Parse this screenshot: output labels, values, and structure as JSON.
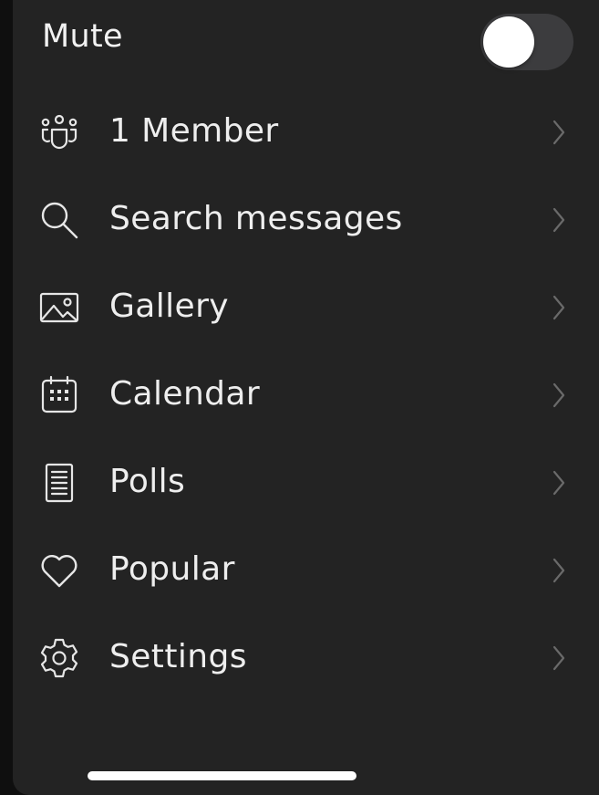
{
  "mute": {
    "label": "Mute",
    "enabled": false
  },
  "menu": {
    "items": [
      {
        "label": "1 Member",
        "icon": "members-icon"
      },
      {
        "label": "Search messages",
        "icon": "search-icon"
      },
      {
        "label": "Gallery",
        "icon": "gallery-icon"
      },
      {
        "label": "Calendar",
        "icon": "calendar-icon"
      },
      {
        "label": "Polls",
        "icon": "polls-icon"
      },
      {
        "label": "Popular",
        "icon": "heart-icon"
      },
      {
        "label": "Settings",
        "icon": "gear-icon"
      }
    ]
  },
  "colors": {
    "background": "#232323",
    "text": "#eeeeee",
    "chevron": "#6a6a6a",
    "toggle_track": "#3c3c3e",
    "toggle_knob": "#ffffff"
  }
}
